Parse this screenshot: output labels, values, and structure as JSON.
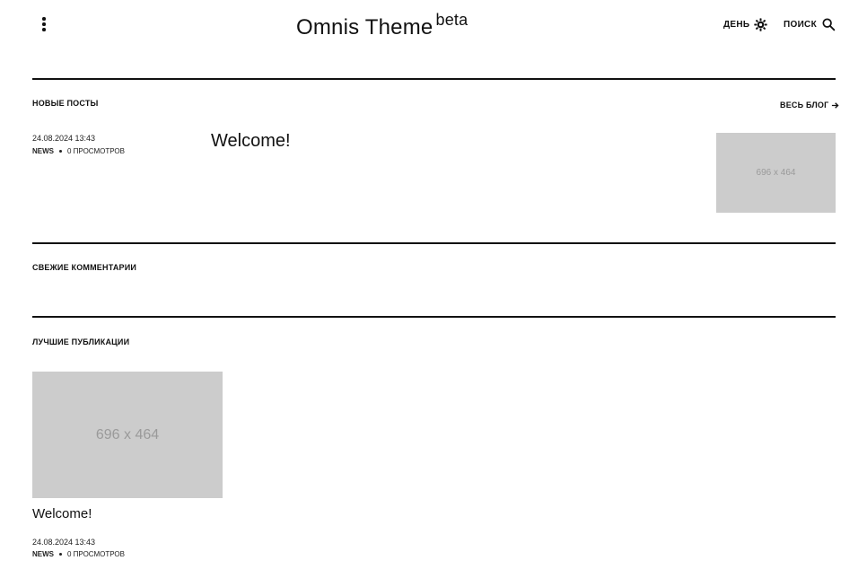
{
  "header": {
    "site_title": "Omnis Theme",
    "site_badge": "beta",
    "day_label": "День",
    "search_label": "Поиск",
    "menu_icon": "more-vertical-icon",
    "day_icon": "sun-icon",
    "search_icon": "search-icon"
  },
  "new_posts": {
    "heading": "Новые посты",
    "all_blog_label": "Весь блог",
    "all_blog_icon": "arrow-right-icon",
    "post": {
      "date": "24.08.2024 13:43",
      "category": "News",
      "views": "0 просмотров",
      "title": "Welcome!",
      "thumb_text": "696 x 464"
    }
  },
  "fresh_comments": {
    "heading": "Свежие комментарии"
  },
  "best_publications": {
    "heading": "Лучшие публикации",
    "post": {
      "thumb_text": "696 x 464",
      "title": "Welcome!",
      "date": "24.08.2024 13:43",
      "category": "News",
      "views": "0 просмотров"
    }
  },
  "colors": {
    "text": "#111111",
    "placeholder_bg": "#cccccc",
    "placeholder_text": "#9a9a9a",
    "background": "#ffffff"
  }
}
